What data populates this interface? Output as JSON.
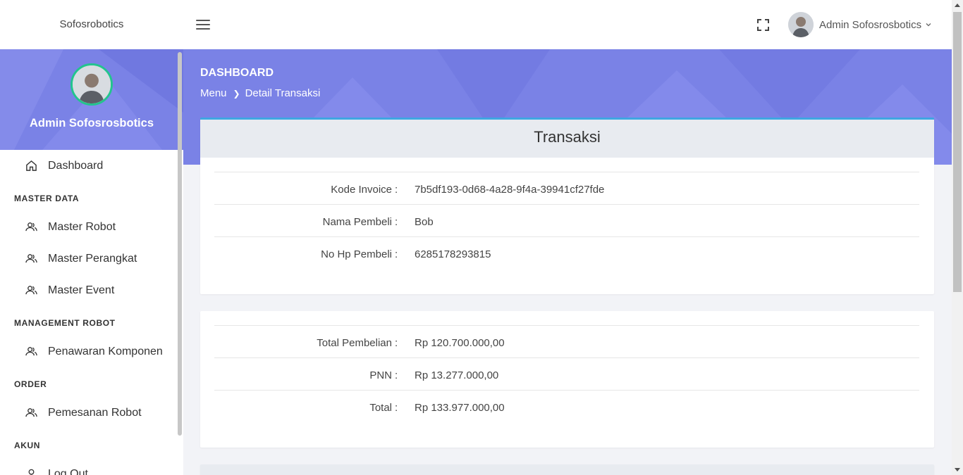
{
  "topbar": {
    "brand": "Sofosrobotics",
    "user_name": "Admin Sofosrosbotics"
  },
  "sidebar": {
    "profile_name": "Admin Sofosrosbotics",
    "dashboard": "Dashboard",
    "sections": [
      {
        "header": "MASTER DATA",
        "items": [
          "Master Robot",
          "Master Perangkat",
          "Master Event"
        ]
      },
      {
        "header": "MANAGEMENT ROBOT",
        "items": [
          "Penawaran Komponen"
        ]
      },
      {
        "header": "ORDER",
        "items": [
          "Pemesanan Robot"
        ]
      },
      {
        "header": "AKUN",
        "items": [
          "Log Out"
        ]
      }
    ]
  },
  "hero": {
    "title": "DASHBOARD",
    "breadcrumb": [
      "Menu",
      "Detail Transaksi"
    ]
  },
  "transaction": {
    "title": "Transaksi",
    "rows": [
      {
        "label": "Kode Invoice",
        "colon": ":",
        "value": "7b5df193-0d68-4a28-9f4a-39941cf27fde"
      },
      {
        "label": "Nama Pembeli",
        "colon": ":",
        "value": "Bob"
      },
      {
        "label": "No Hp Pembeli",
        "colon": ":",
        "value": "6285178293815"
      }
    ]
  },
  "totals": {
    "rows": [
      {
        "label": "Total Pembelian",
        "colon": ":",
        "value": "Rp 120.700.000,00"
      },
      {
        "label": "PNN",
        "colon": ":",
        "value": "Rp 13.277.000,00"
      },
      {
        "label": "Total",
        "colon": ":",
        "value": "Rp 133.977.000,00"
      }
    ]
  },
  "colors": {
    "accent": "#7a82e6",
    "card_top_border": "#3fa7e1",
    "avatar_ring": "#23c48e"
  }
}
